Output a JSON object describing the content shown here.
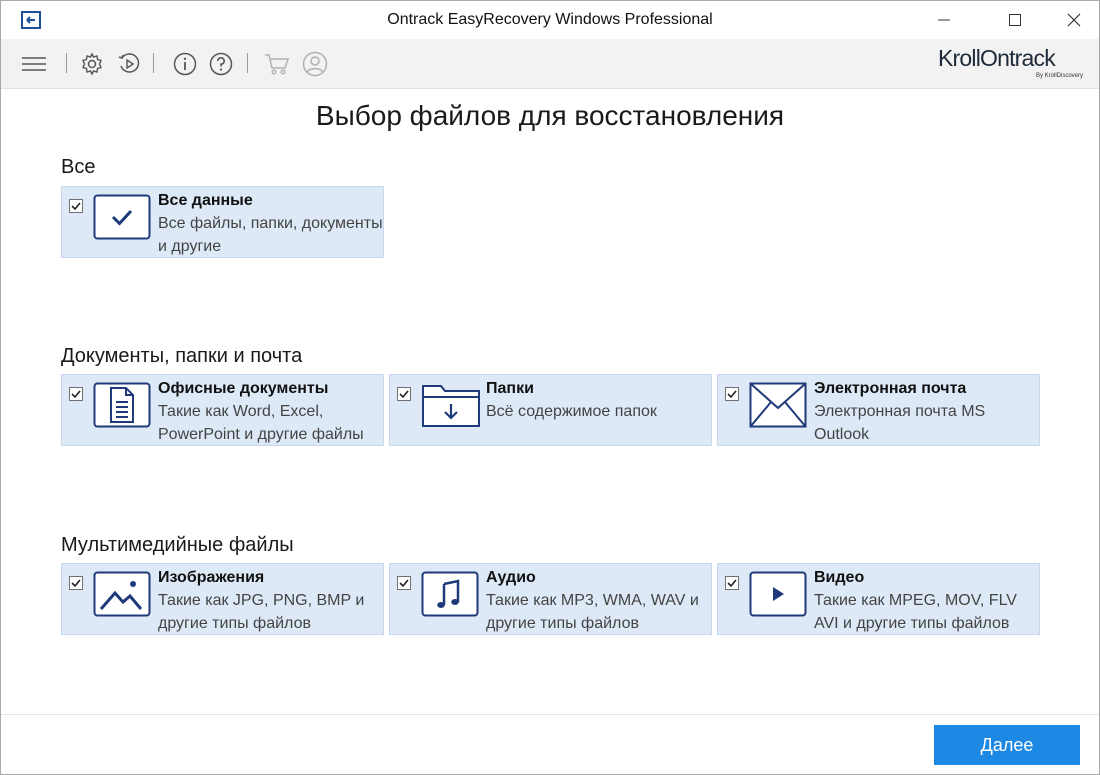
{
  "window": {
    "title": "Ontrack EasyRecovery Windows Professional"
  },
  "toolbar": {
    "icons": [
      "menu-icon",
      "settings-icon",
      "resume-recovery-icon",
      "info-icon",
      "help-icon",
      "cart-icon",
      "account-icon"
    ],
    "logo_text": "KrollOntrack",
    "logo_sub": "By KrollDiscovery"
  },
  "main": {
    "page_title": "Выбор файлов для восстановления",
    "sections": [
      {
        "title": "Все",
        "cards": [
          {
            "title": "Все данные",
            "desc": "Все файлы, папки, документы и другие",
            "checked": true,
            "icon": "checkmark-icon"
          }
        ]
      },
      {
        "title": "Документы, папки и почта",
        "cards": [
          {
            "title": "Офисные документы",
            "desc": "Такие как Word, Excel, PowerPoint и другие файлы",
            "checked": true,
            "icon": "document-icon"
          },
          {
            "title": "Папки",
            "desc": "Всё содержимое папок",
            "checked": true,
            "icon": "folder-icon"
          },
          {
            "title": "Электронная почта",
            "desc": "Электронная почта MS Outlook",
            "checked": true,
            "icon": "envelope-icon"
          }
        ]
      },
      {
        "title": "Мультимедийные файлы",
        "cards": [
          {
            "title": "Изображения",
            "desc": "Такие как JPG, PNG, BMP и другие типы файлов",
            "checked": true,
            "icon": "image-icon"
          },
          {
            "title": "Аудио",
            "desc": "Такие как MP3, WMA, WAV и другие типы файлов",
            "checked": true,
            "icon": "music-note-icon"
          },
          {
            "title": "Видео",
            "desc": "Такие как MPEG, MOV, FLV AVI и другие типы файлов",
            "checked": true,
            "icon": "play-icon"
          }
        ]
      }
    ]
  },
  "footer": {
    "next_label": "Далее"
  },
  "colors": {
    "accent": "#1e88e5",
    "card_bg": "#dde9f7",
    "icon_navy": "#1f3a7a"
  }
}
